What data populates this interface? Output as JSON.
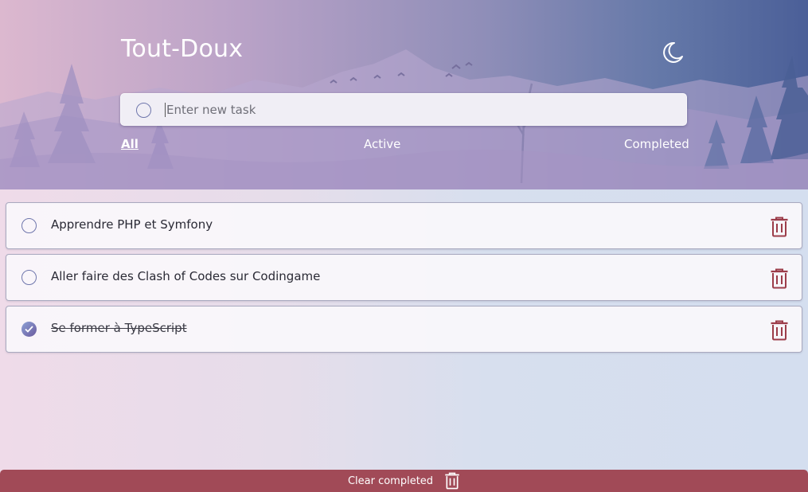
{
  "header": {
    "title": "Tout-Doux",
    "theme_icon": "moon-icon"
  },
  "new_task": {
    "placeholder": "Enter new task",
    "value": ""
  },
  "filters": {
    "all": "All",
    "active": "Active",
    "completed": "Completed",
    "selected": "All"
  },
  "tasks": [
    {
      "label": "Apprendre PHP et Symfony",
      "completed": false
    },
    {
      "label": "Aller faire des Clash of Codes sur Codingame",
      "completed": false
    },
    {
      "label": "Se former à TypeScript",
      "completed": true
    }
  ],
  "footer": {
    "clear_label": "Clear completed",
    "icon": "trash-icon"
  },
  "colors": {
    "accent": "#a14a57",
    "check_ring": "#6f76ac",
    "trash": "#9c3d4a"
  }
}
